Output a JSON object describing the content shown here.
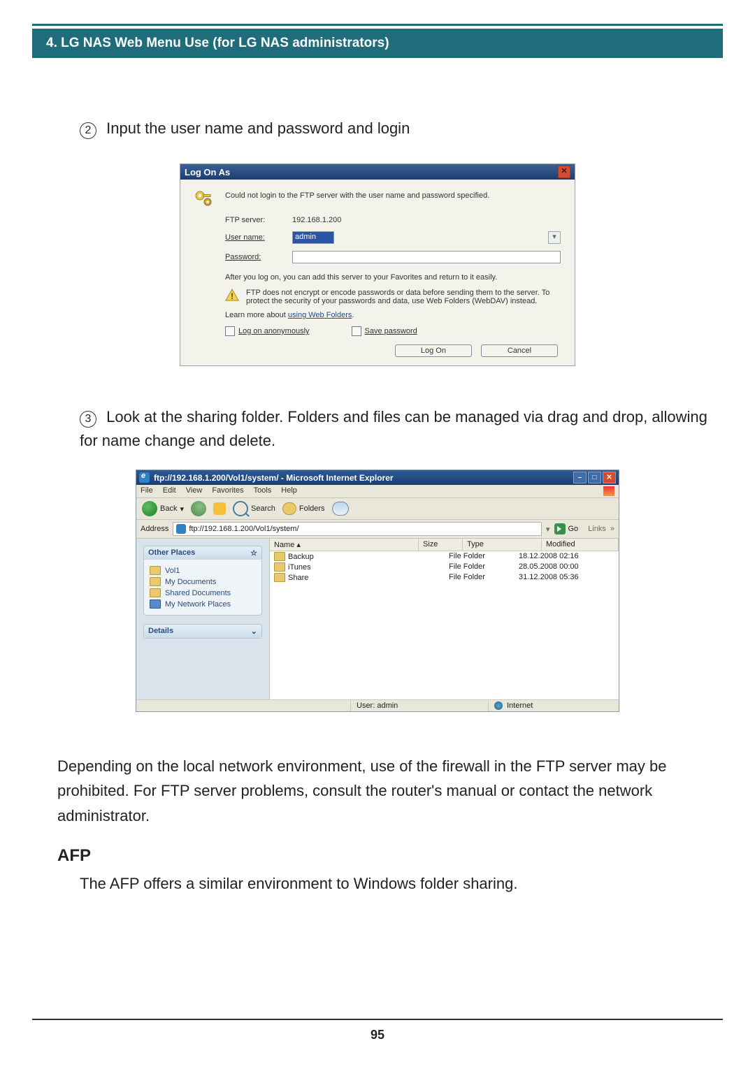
{
  "banner": "4. LG NAS Web Menu Use (for LG NAS administrators)",
  "step2": {
    "num": "2",
    "text": "Input the user name and password and login"
  },
  "logon": {
    "title": "Log On As",
    "message": "Could not login to the FTP server with the user name and password specified.",
    "server_label": "FTP server:",
    "server_value": "192.168.1.200",
    "user_label": "User name:",
    "user_value": "admin",
    "pass_label": "Password:",
    "after": "After you log on, you can add this server to your Favorites and return to it easily.",
    "warn": "FTP does not encrypt or encode passwords or data before sending them to the server. To protect the security of your passwords and data, use Web Folders (WebDAV) instead.",
    "learn_prefix": "Learn more about ",
    "learn_link": "using Web Folders",
    "learn_suffix": ".",
    "chk_anon": "Log on anonymously",
    "chk_save": "Save password",
    "btn_logon": "Log On",
    "btn_cancel": "Cancel"
  },
  "step3": {
    "num": "3",
    "text": "Look at the sharing folder. Folders and files can be managed via drag and drop, allowing for name change and delete."
  },
  "explorer": {
    "title": "ftp://192.168.1.200/Vol1/system/ - Microsoft Internet Explorer",
    "menu": [
      "File",
      "Edit",
      "View",
      "Favorites",
      "Tools",
      "Help"
    ],
    "toolbar": {
      "back": "Back",
      "search": "Search",
      "folders": "Folders"
    },
    "address_label": "Address",
    "address_value": "ftp://192.168.1.200/Vol1/system/",
    "go": "Go",
    "links": "Links",
    "side": {
      "other_title": "Other Places",
      "places": [
        "Vol1",
        "My Documents",
        "Shared Documents",
        "My Network Places"
      ],
      "details_title": "Details"
    },
    "columns": {
      "name": "Name",
      "size": "Size",
      "type": "Type",
      "modified": "Modified"
    },
    "rows": [
      {
        "name": "Backup",
        "type": "File Folder",
        "modified": "18.12.2008 02:16"
      },
      {
        "name": "iTunes",
        "type": "File Folder",
        "modified": "28.05.2008 00:00"
      },
      {
        "name": "Share",
        "type": "File Folder",
        "modified": "31.12.2008 05:36"
      }
    ],
    "status_user": "User: admin",
    "status_net": "Internet"
  },
  "para1": "Depending on the local network environment, use of the firewall in the FTP server may be prohibited. For FTP server problems, consult the router's manual or contact the network administrator.",
  "afp_heading": "AFP",
  "para2": "The AFP offers a similar environment to Windows folder sharing.",
  "page_number": "95"
}
